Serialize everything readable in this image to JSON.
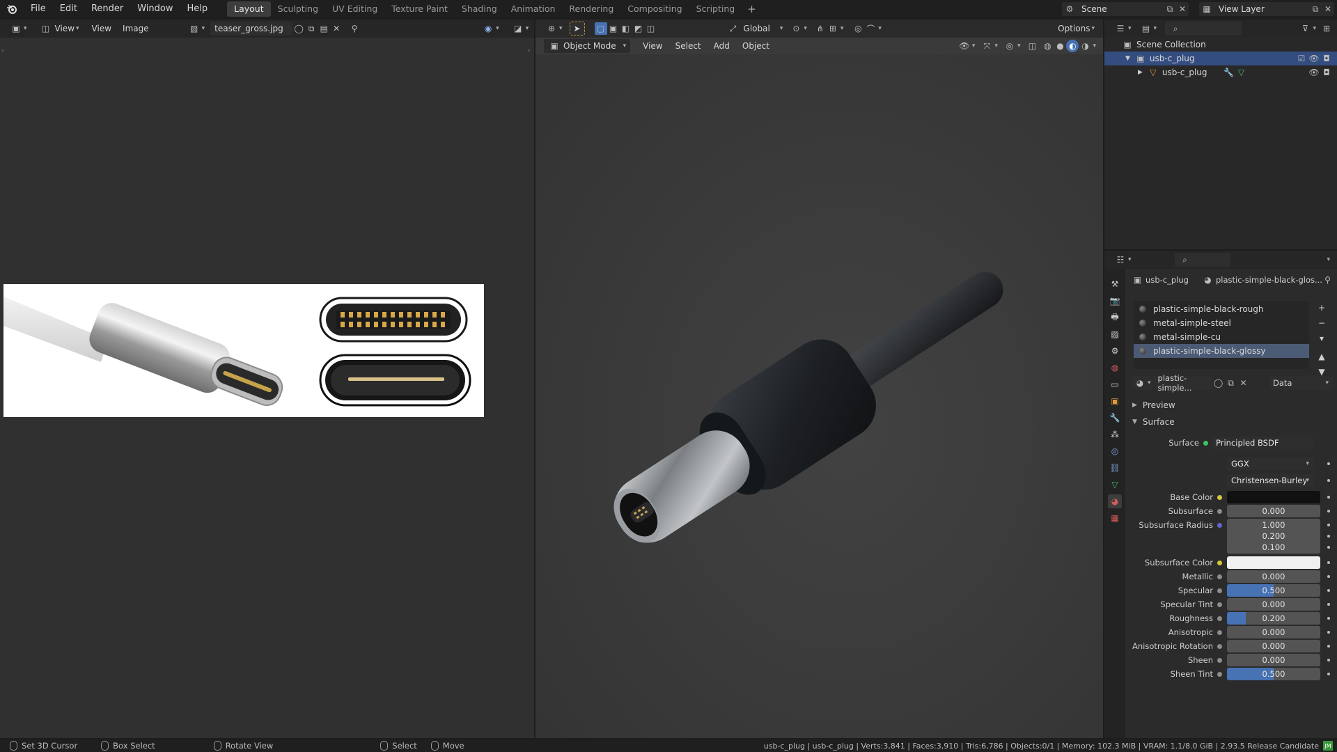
{
  "menus": [
    "File",
    "Edit",
    "Render",
    "Window",
    "Help"
  ],
  "workspaces": [
    "Layout",
    "Sculpting",
    "UV Editing",
    "Texture Paint",
    "Shading",
    "Animation",
    "Rendering",
    "Compositing",
    "Scripting"
  ],
  "active_workspace": "Layout",
  "scene": {
    "label": "Scene"
  },
  "view_layer": {
    "label": "View Layer"
  },
  "image_editor": {
    "view_menu": "View",
    "menu_view": "View",
    "menu_image": "Image",
    "image_name": "teaser_gross.jpg"
  },
  "viewport": {
    "mode": "Object Mode",
    "menus": [
      "View",
      "Select",
      "Add",
      "Object"
    ],
    "transform_orientation": "Global",
    "options": "Options"
  },
  "outliner": {
    "collection": "Scene Collection",
    "items": [
      {
        "label": "usb-c_plug",
        "type": "collection"
      },
      {
        "label": "usb-c_plug",
        "type": "object"
      }
    ]
  },
  "properties": {
    "breadcrumb_object": "usb-c_plug",
    "breadcrumb_material": "plastic-simple-black-glos...",
    "materials": [
      "plastic-simple-black-rough",
      "metal-simple-steel",
      "metal-simple-cu",
      "plastic-simple-black-glossy"
    ],
    "selected_material_index": 3,
    "material_field": "plastic-simple...",
    "link_mode": "Data",
    "panels": {
      "preview": "Preview",
      "surface": "Surface"
    },
    "surface_label": "Surface",
    "surface_value": "Principled BSDF",
    "distribution": "GGX",
    "subsurface_method": "Christensen-Burley",
    "rows": [
      {
        "label": "Base Color",
        "value": "",
        "fill": 0,
        "kind": "color",
        "swatch": "#111111",
        "dot": "#d6c53c"
      },
      {
        "label": "Subsurface",
        "value": "0.000",
        "fill": 0,
        "kind": "num",
        "dot": "#8c8c8c"
      },
      {
        "label": "Subsurface Radius",
        "value": "1.000",
        "fill": 0,
        "kind": "num",
        "dot": "#6464c8"
      },
      {
        "label": "",
        "value": "0.200",
        "fill": 0,
        "kind": "num"
      },
      {
        "label": "",
        "value": "0.100",
        "fill": 0,
        "kind": "num"
      },
      {
        "label": "Subsurface Color",
        "value": "",
        "fill": 0,
        "kind": "color",
        "swatch": "#f0f0f0",
        "dot": "#d6c53c"
      },
      {
        "label": "Metallic",
        "value": "0.000",
        "fill": 0,
        "kind": "num",
        "dot": "#8c8c8c"
      },
      {
        "label": "Specular",
        "value": "0.500",
        "fill": 0.5,
        "kind": "num",
        "dot": "#8c8c8c"
      },
      {
        "label": "Specular Tint",
        "value": "0.000",
        "fill": 0,
        "kind": "num",
        "dot": "#8c8c8c"
      },
      {
        "label": "Roughness",
        "value": "0.200",
        "fill": 0.2,
        "kind": "num",
        "dot": "#8c8c8c"
      },
      {
        "label": "Anisotropic",
        "value": "0.000",
        "fill": 0,
        "kind": "num",
        "dot": "#8c8c8c"
      },
      {
        "label": "Anisotropic Rotation",
        "value": "0.000",
        "fill": 0,
        "kind": "num",
        "dot": "#8c8c8c"
      },
      {
        "label": "Sheen",
        "value": "0.000",
        "fill": 0,
        "kind": "num",
        "dot": "#8c8c8c"
      },
      {
        "label": "Sheen Tint",
        "value": "0.500",
        "fill": 0.5,
        "kind": "num",
        "dot": "#8c8c8c"
      }
    ]
  },
  "status": {
    "left": [
      "Set 3D Cursor",
      "Box Select",
      "Rotate View",
      "Select",
      "Move"
    ],
    "right": "usb-c_plug | usb-c_plug | Verts:3,841 | Faces:3,910 | Tris:6,786 | Objects:0/1 | Memory: 102.3 MiB | VRAM: 1.1/8.0 GiB | 2.93.5 Release Candidate"
  }
}
